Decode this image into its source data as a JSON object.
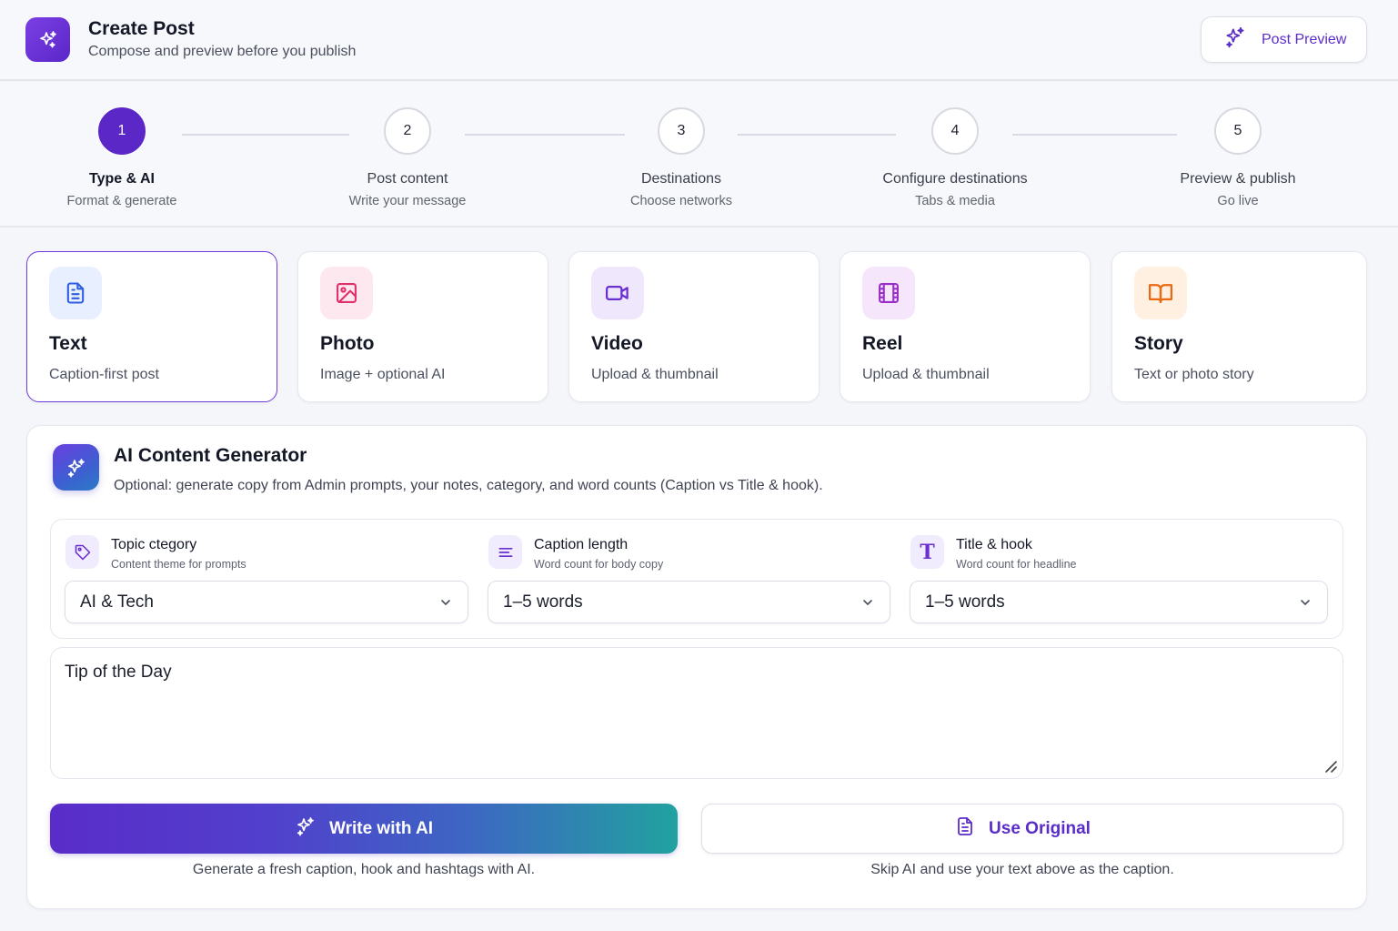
{
  "header": {
    "title": "Create Post",
    "subtitle": "Compose and preview before you publish",
    "preview_label": "Post Preview"
  },
  "steps": [
    {
      "number": "1",
      "title": "Type & AI",
      "subtitle": "Format & generate",
      "active": true
    },
    {
      "number": "2",
      "title": "Post content",
      "subtitle": "Write your message",
      "active": false
    },
    {
      "number": "3",
      "title": "Destinations",
      "subtitle": "Choose networks",
      "active": false
    },
    {
      "number": "4",
      "title": "Configure destinations",
      "subtitle": "Tabs & media",
      "active": false
    },
    {
      "number": "5",
      "title": "Preview & publish",
      "subtitle": "Go live",
      "active": false
    }
  ],
  "post_types": [
    {
      "name": "Text",
      "description": "Caption-first post",
      "icon": "document-icon",
      "color": "#2f5fe0",
      "bg": "#e8efff",
      "selected": true
    },
    {
      "name": "Photo",
      "description": "Image + optional AI",
      "icon": "image-icon",
      "color": "#e0306c",
      "bg": "#fde8ef",
      "selected": false
    },
    {
      "name": "Video",
      "description": "Upload & thumbnail",
      "icon": "video-camera-icon",
      "color": "#6a2fd0",
      "bg": "#efe8fd",
      "selected": false
    },
    {
      "name": "Reel",
      "description": "Upload & thumbnail",
      "icon": "film-icon",
      "color": "#9a2fc8",
      "bg": "#f6e6fb",
      "selected": false
    },
    {
      "name": "Story",
      "description": "Text or photo story",
      "icon": "book-open-icon",
      "color": "#ea6a12",
      "bg": "#fff0e2",
      "selected": false
    }
  ],
  "ai": {
    "title": "AI Content Generator",
    "description": "Optional: generate copy from Admin prompts, your notes, category, and word counts (Caption vs Title & hook).",
    "options": [
      {
        "label": "Topic ctegory",
        "hint": "Content theme for prompts",
        "value": "AI & Tech",
        "icon": "tag-icon"
      },
      {
        "label": "Caption length",
        "hint": "Word count for body copy",
        "value": "1–5 words",
        "icon": "align-left-icon"
      },
      {
        "label": "Title & hook",
        "hint": "Word count for headline",
        "value": "1–5 words",
        "icon": "text-type-icon"
      }
    ],
    "notes_value": "Tip of the Day",
    "write_label": "Write with AI",
    "write_hint": "Generate a fresh caption, hook and hashtags with AI.",
    "original_label": "Use Original",
    "original_hint": "Skip AI and use your text above as the caption."
  },
  "colors": {
    "accent": "#5a2cc9",
    "accent_light": "#f1ecfd"
  }
}
